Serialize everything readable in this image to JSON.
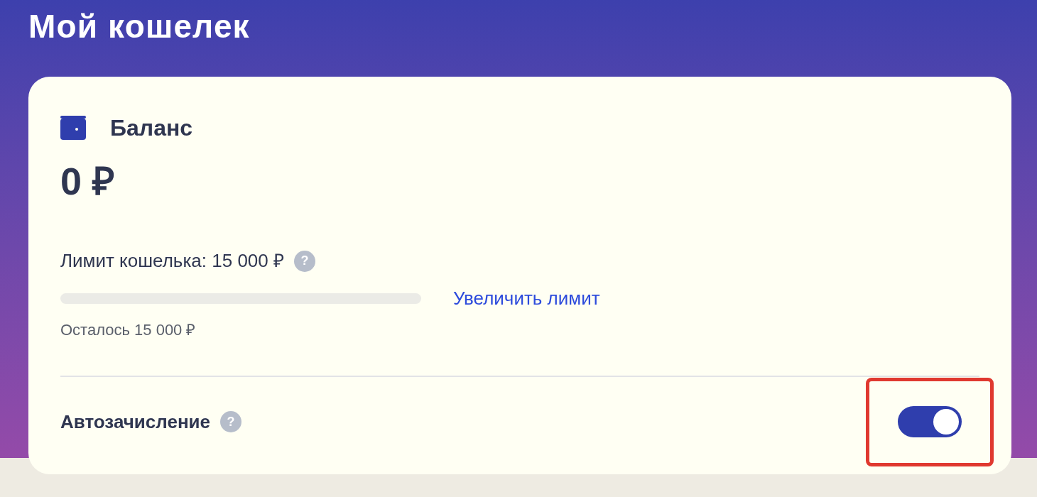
{
  "page": {
    "title": "Мой кошелек"
  },
  "balance_card": {
    "title": "Баланс",
    "amount": "0 ₽",
    "limit": {
      "label": "Лимит кошелька: 15 000 ₽",
      "help": "?",
      "level": 0,
      "remaining": "Осталось 15 000 ₽",
      "link": "Увеличить лимит"
    },
    "auto_top_up": {
      "label": "Автозачисление",
      "help": "?",
      "on": true,
      "highlighted": true
    }
  }
}
